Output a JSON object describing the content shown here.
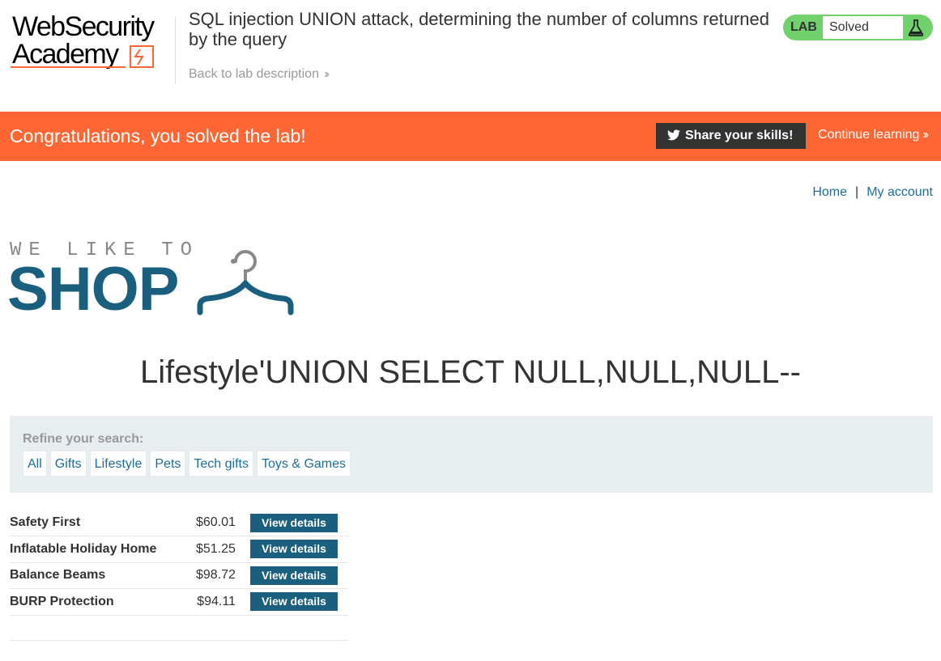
{
  "academy": {
    "logo_line1": "WebSecurity",
    "logo_line2": "Academy",
    "lab_title": "SQL injection UNION attack, determining the number of columns returned by the query",
    "back_link": "Back to lab description",
    "status_tag": "LAB",
    "status_value": "Solved",
    "status_color": "#70d16d"
  },
  "banner": {
    "message": "Congratulations, you solved the lab!",
    "share_label": "Share your skills!",
    "continue_label": "Continue learning",
    "background": "#ff6633"
  },
  "nav": {
    "home": "Home",
    "separator": "|",
    "account": "My account"
  },
  "shop_logo": {
    "tagline": "WE LIKE TO",
    "word": "SHOP",
    "icon": "hanger-icon"
  },
  "heading": "Lifestyle'UNION SELECT NULL,NULL,NULL--",
  "filters": {
    "label": "Refine your search:",
    "categories": [
      "All",
      "Gifts",
      "Lifestyle",
      "Pets",
      "Tech gifts",
      "Toys & Games"
    ]
  },
  "products": [
    {
      "name": "Safety First",
      "price": "$60.01",
      "action": "View details"
    },
    {
      "name": "Inflatable Holiday Home",
      "price": "$51.25",
      "action": "View details"
    },
    {
      "name": "Balance Beams",
      "price": "$98.72",
      "action": "View details"
    },
    {
      "name": "BURP Protection",
      "price": "$94.11",
      "action": "View details"
    }
  ]
}
